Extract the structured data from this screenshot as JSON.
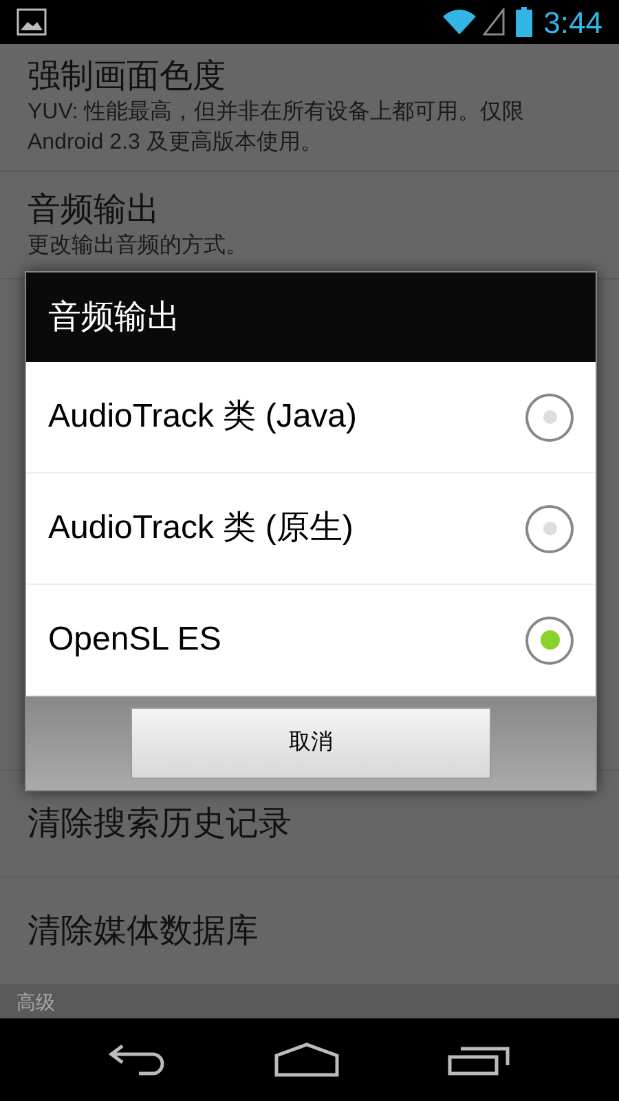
{
  "status_bar": {
    "time": "3:44"
  },
  "settings": [
    {
      "kind": "item",
      "title": "强制画面色度",
      "summary": "YUV: 性能最高，但并非在所有设备上都可用。仅限 Android 2.3 及更高版本使用。"
    },
    {
      "kind": "item",
      "title": "音频输出",
      "summary": "更改输出音频的方式。"
    },
    {
      "kind": "hidden"
    },
    {
      "kind": "item",
      "title": "清除搜索历史记录"
    },
    {
      "kind": "item",
      "title": "清除媒体数据库"
    },
    {
      "kind": "header",
      "title": "高级"
    }
  ],
  "dialog": {
    "title": "音频输出",
    "options": [
      {
        "label": "AudioTrack 类 (Java)",
        "selected": false
      },
      {
        "label": "AudioTrack 类 (原生)",
        "selected": false
      },
      {
        "label": "OpenSL ES",
        "selected": true
      }
    ],
    "cancel_button": "取消"
  }
}
